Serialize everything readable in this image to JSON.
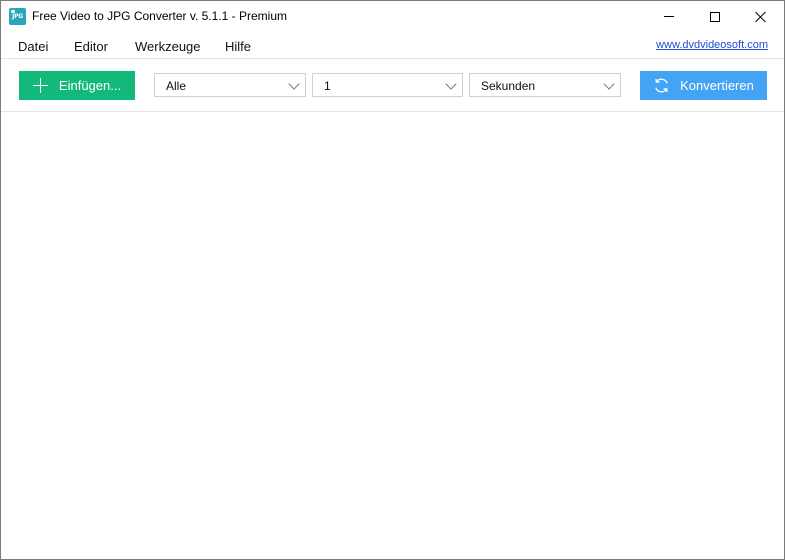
{
  "window": {
    "title": "Free Video to JPG Converter v. 5.1.1 - Premium",
    "icon": "jpg-app-icon",
    "icon_text": "JPG"
  },
  "menu": {
    "items": [
      "Datei",
      "Editor",
      "Werkzeuge",
      "Hilfe"
    ],
    "link": "www.dvdvideosoft.com"
  },
  "toolbar": {
    "add_label": "Einfügen...",
    "add_icon": "plus-icon",
    "frames_select": "Alle",
    "interval_select": "1",
    "unit_select": "Sekunden",
    "convert_label": "Konvertieren",
    "convert_icon": "refresh-icon"
  },
  "colors": {
    "add_button": "#13b97a",
    "convert_button": "#43a4f5",
    "link": "#1a4fd6"
  }
}
